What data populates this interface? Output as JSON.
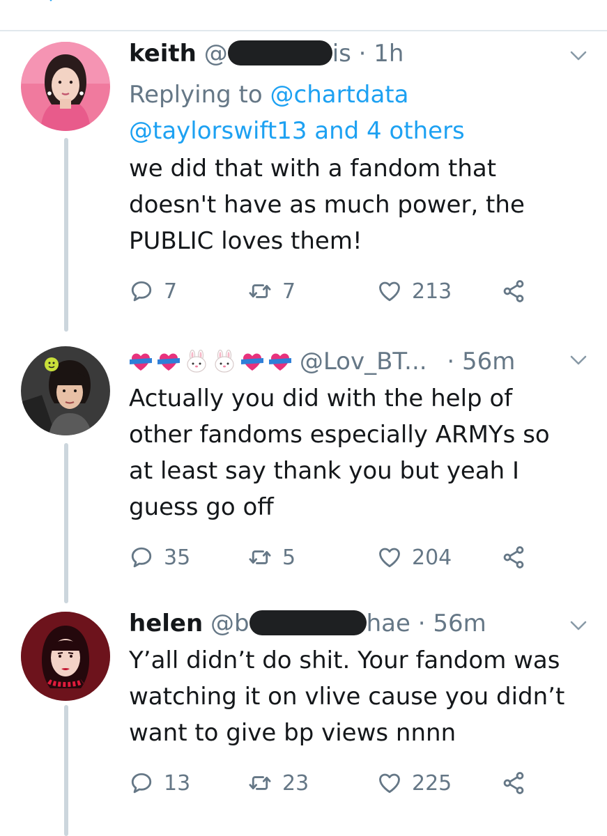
{
  "colors": {
    "link": "#1da1f2",
    "muted": "#657786",
    "text": "#14171a",
    "divider": "#e1e8ed",
    "thread": "#ccd6dd"
  },
  "tweets": [
    {
      "name": "keith",
      "handle_start": "@",
      "handle_end": "is",
      "time": "1h",
      "replying_prefix": "Replying to ",
      "mention_1": "@chartdata",
      "mention_2": "@taylorswift13 and 4 others",
      "body_lines": [
        "we did that with a fandom that",
        "doesn't have as much power, the",
        "PUBLIC loves them!"
      ],
      "replies": "7",
      "retweets": "7",
      "likes": "213"
    },
    {
      "name_emojis": [
        "heart-ribbon",
        "heart-ribbon",
        "rabbit-face",
        "rabbit-face",
        "heart-ribbon",
        "heart-ribbon"
      ],
      "handle": "@Lov_BT...",
      "time": "56m",
      "body_lines": [
        "Actually you did with the help of",
        "other fandoms especially ARMYs so",
        "at least say thank you but yeah I",
        "guess go off"
      ],
      "replies": "35",
      "retweets": "5",
      "likes": "204"
    },
    {
      "name": "helen",
      "handle_start": "@b",
      "handle_end": "hae",
      "time": "56m",
      "body_lines": [
        "Y’all didn’t do shit. Your fandom was",
        "watching it on vlive cause you didn’t",
        "want to give bp views nnnn"
      ],
      "replies": "13",
      "retweets": "23",
      "likes": "225"
    }
  ],
  "separator": "·",
  "icons": {
    "reply": "reply-icon",
    "retweet": "retweet-icon",
    "like": "heart-icon",
    "share": "share-icon",
    "menu": "chevron-down-icon"
  }
}
